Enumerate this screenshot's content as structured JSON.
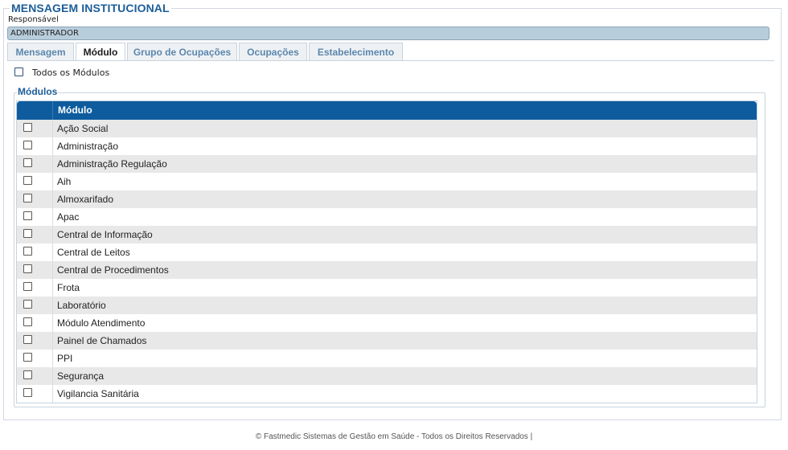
{
  "page_title": "MENSAGEM INSTITUCIONAL",
  "responsavel": {
    "label": "Responsável",
    "value": "ADMINISTRADOR"
  },
  "tabs": [
    {
      "label": "Mensagem",
      "active": false
    },
    {
      "label": "Módulo",
      "active": true
    },
    {
      "label": "Grupo de Ocupações",
      "active": false
    },
    {
      "label": "Ocupações",
      "active": false
    },
    {
      "label": "Estabelecimento",
      "active": false
    }
  ],
  "todos_modulos": {
    "label": "Todos os Módulos",
    "checked": false
  },
  "modulos": {
    "legend": "Módulos",
    "column_header": "Módulo",
    "rows": [
      {
        "label": "Ação Social",
        "checked": false
      },
      {
        "label": "Administração",
        "checked": false
      },
      {
        "label": "Administração Regulação",
        "checked": false
      },
      {
        "label": "Aih",
        "checked": false
      },
      {
        "label": "Almoxarifado",
        "checked": false
      },
      {
        "label": "Apac",
        "checked": false
      },
      {
        "label": "Central de Informação",
        "checked": false
      },
      {
        "label": "Central de Leitos",
        "checked": false
      },
      {
        "label": "Central de Procedimentos",
        "checked": false
      },
      {
        "label": "Frota",
        "checked": false
      },
      {
        "label": "Laboratório",
        "checked": false
      },
      {
        "label": "Módulo Atendimento",
        "checked": false
      },
      {
        "label": "Painel de Chamados",
        "checked": false
      },
      {
        "label": "PPI",
        "checked": false
      },
      {
        "label": "Segurança",
        "checked": false
      },
      {
        "label": "Vigilancia Sanitária",
        "checked": false
      }
    ]
  },
  "footer": "© Fastmedic Sistemas de Gestão em Saúde - Todos os Direitos Reservados |",
  "colors": {
    "title": "#1d5d98",
    "grid_header": "#0e5c9e",
    "field_bg": "#b8cddb",
    "row_alt": "#e8e8e8"
  }
}
